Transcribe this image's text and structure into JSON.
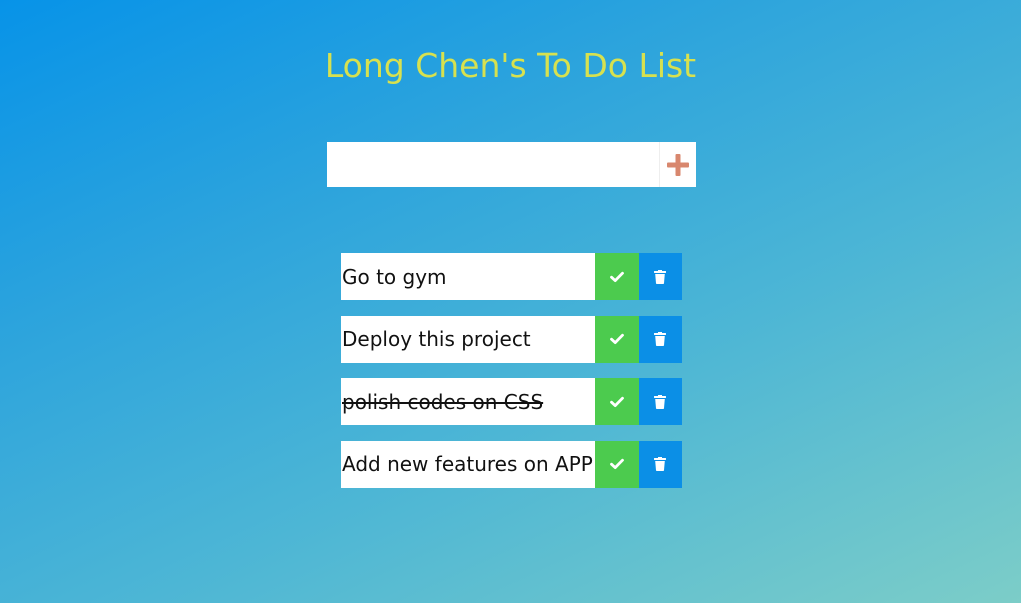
{
  "header": {
    "title": "Long Chen's To Do List"
  },
  "form": {
    "input_value": "",
    "add_icon": "plus-icon"
  },
  "todos": [
    {
      "text": "Go to gym",
      "completed": false
    },
    {
      "text": "Deploy this project",
      "completed": false
    },
    {
      "text": "polish codes on CSS",
      "completed": true
    },
    {
      "text": "Add new features on APP",
      "completed": false
    }
  ],
  "icons": {
    "complete": "check-icon",
    "delete": "trash-icon"
  },
  "colors": {
    "title": "#d7e14f",
    "plus": "#d8876e",
    "complete_button": "#4ccb4e",
    "delete_button": "#0b8fe6"
  }
}
